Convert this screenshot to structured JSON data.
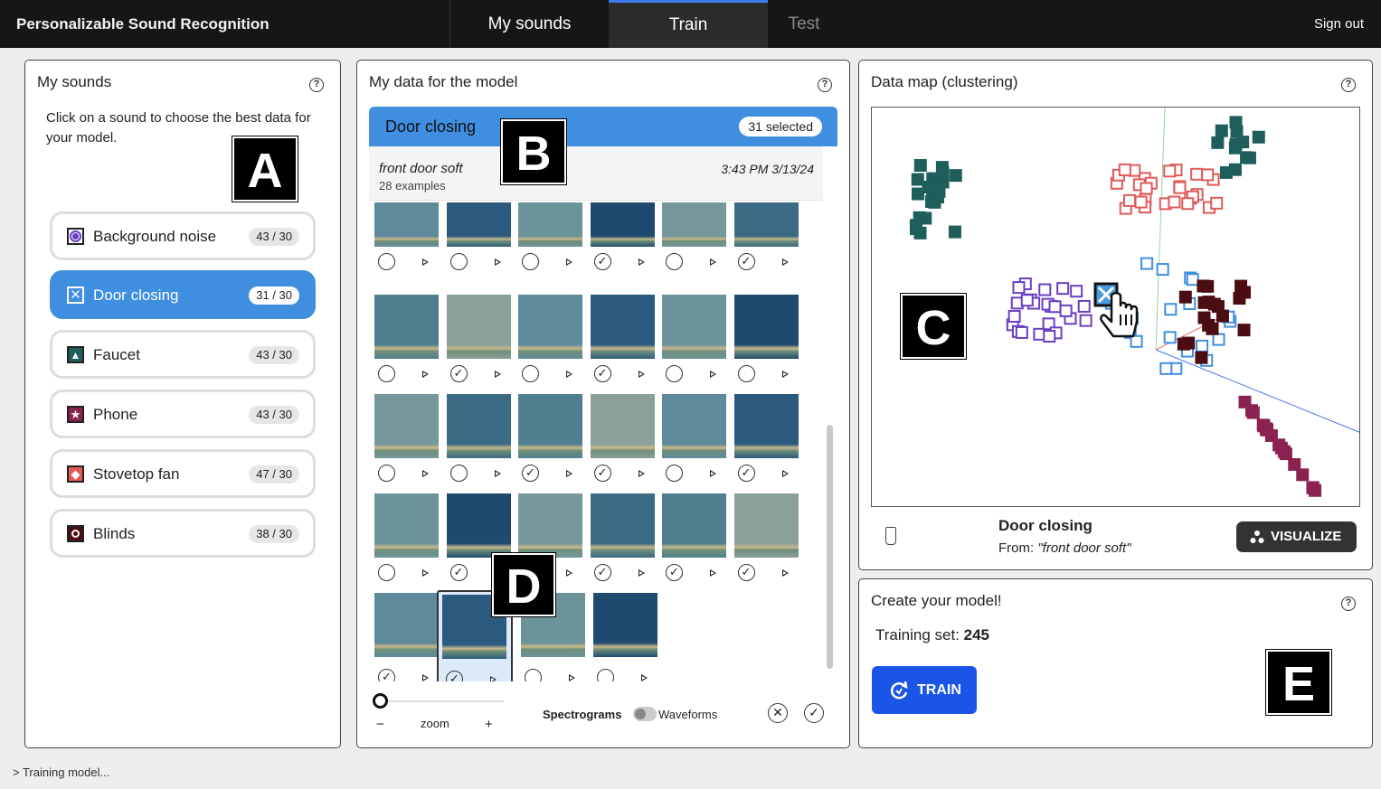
{
  "app": {
    "title": "Personalizable Sound Recognition",
    "signout": "Sign out"
  },
  "tabs": {
    "sounds": "My sounds",
    "train": "Train",
    "test": "Test"
  },
  "sounds_panel": {
    "title": "My sounds",
    "instruction": "Click on a sound to choose the best data for your model.",
    "items": [
      {
        "label": "Background noise",
        "count": "43 / 30",
        "color": "#6a3ec2"
      },
      {
        "label": "Door closing",
        "count": "31 / 30",
        "color": "#3f8ee0"
      },
      {
        "label": "Faucet",
        "count": "43 / 30",
        "color": "#1f5e5a"
      },
      {
        "label": "Phone",
        "count": "43 / 30",
        "color": "#8b2350"
      },
      {
        "label": "Stovetop fan",
        "count": "47 / 30",
        "color": "#e05a5a"
      },
      {
        "label": "Blinds",
        "count": "38 / 30",
        "color": "#4a0e12"
      }
    ]
  },
  "data_panel": {
    "title": "My data for the model",
    "sound": "Door closing",
    "selected": "31 selected",
    "recording": {
      "name": "front door soft",
      "examples": "28 examples",
      "time": "3:43 PM 3/13/24"
    },
    "zoom": "zoom",
    "zoom_minus": "−",
    "zoom_plus": "+",
    "toggle_left": "Spectrograms",
    "toggle_right": "Waveforms",
    "checks": [
      [
        false,
        false,
        false,
        true,
        false,
        true
      ],
      [
        false,
        true,
        false,
        true,
        false,
        false
      ],
      [
        false,
        false,
        true,
        true,
        false,
        true
      ],
      [
        false,
        true,
        false,
        true,
        true,
        true
      ],
      [
        true,
        true,
        false,
        false
      ]
    ]
  },
  "map_panel": {
    "title": "Data map (clustering)",
    "sound": "Door closing",
    "from_label": "From: ",
    "from_value": "\"front door soft\"",
    "visualize": "VISUALIZE"
  },
  "model_panel": {
    "title": "Create your model!",
    "training_label": "Training set: ",
    "training_value": "245",
    "train": "TRAIN"
  },
  "letters": {
    "a": "A",
    "b": "B",
    "c": "C",
    "d": "D",
    "e": "E"
  },
  "status": "> Training model..."
}
